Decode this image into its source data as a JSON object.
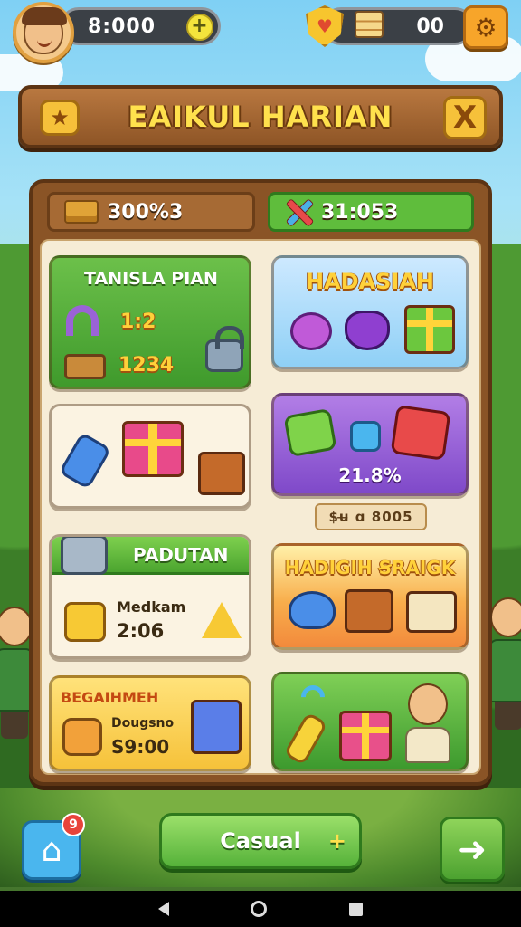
{
  "hud": {
    "coins": "8:000",
    "coins_plus": "+",
    "gems": "00",
    "settings_icon": "gear-icon"
  },
  "banner": {
    "title": "EAIKUL HARIAN",
    "close_label": "X"
  },
  "stats": {
    "left_value": "300%3",
    "right_value": "31:053"
  },
  "cards": {
    "daily": {
      "title": "TANISLA PIAN",
      "line1": "1:2",
      "line2": "1234"
    },
    "gift": {
      "title": "HADASIAH"
    },
    "bonus": {
      "percent": "21.8%"
    },
    "price_tag": "$u̶ ɑ 8005",
    "paduan": {
      "title": "PADUTAN",
      "label": "Medkam",
      "time": "2:06"
    },
    "hadiah": {
      "title": "HADIGIH ꞨRAIGK"
    },
    "bergabung": {
      "title": "BEGAIHMEH",
      "label": "Dougsno",
      "value": "S9:00"
    }
  },
  "bottom": {
    "casual_label": "Casual",
    "casual_plus": "+",
    "home_badge": "9"
  },
  "colors": {
    "accent_green": "#5fbd3c",
    "wood": "#8a5426",
    "gold": "#ffd13a"
  }
}
